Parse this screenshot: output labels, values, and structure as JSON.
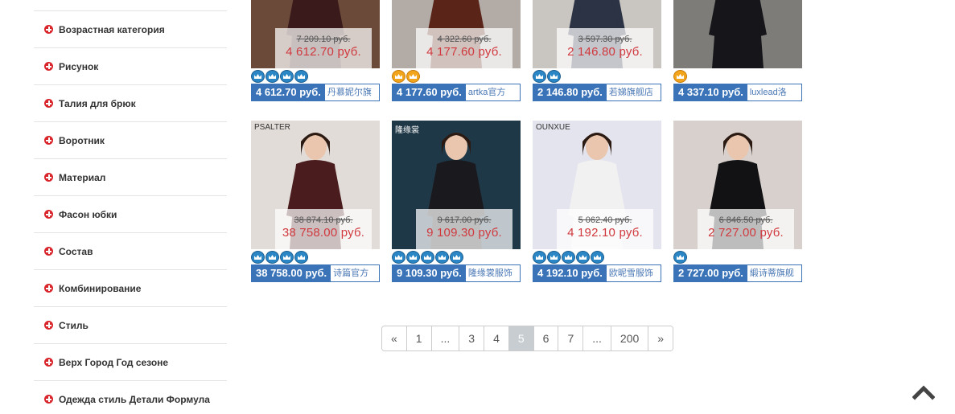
{
  "sidebar": {
    "items": [
      {
        "label": "Возрастная категория"
      },
      {
        "label": "Рисунок"
      },
      {
        "label": "Талия для брюк"
      },
      {
        "label": "Воротник"
      },
      {
        "label": "Материал"
      },
      {
        "label": "Фасон юбки"
      },
      {
        "label": "Состав"
      },
      {
        "label": "Комбинирование"
      },
      {
        "label": "Стиль"
      },
      {
        "label": "Верх Город Год сезоне"
      },
      {
        "label": "Одежда стиль Детали Формула"
      }
    ]
  },
  "products": [
    {
      "old_price": "7 209.10 руб.",
      "new_price": "4 612.70 руб.",
      "buy_price": "4 612.70 руб.",
      "shop": "丹慕妮尔旗",
      "crowns": [
        "blue",
        "blue",
        "blue",
        "blue"
      ],
      "bg": "#6b4a3a",
      "dress": "#3a1a1a"
    },
    {
      "old_price": "4 322.60 руб.",
      "new_price": "4 177.60 руб.",
      "buy_price": "4 177.60 руб.",
      "shop": "artka官方",
      "crowns": [
        "gold",
        "gold"
      ],
      "bg": "#b3aca6",
      "dress": "#5a2418"
    },
    {
      "old_price": "3 597.30 руб.",
      "new_price": "2 146.80 руб.",
      "buy_price": "2 146.80 руб.",
      "shop": "若娣旗舰店",
      "crowns": [
        "blue",
        "blue"
      ],
      "bg": "#c9c6c2",
      "dress": "#2b3344"
    },
    {
      "old_price": "",
      "new_price": "",
      "buy_price": "4 337.10 руб.",
      "shop": "luxlead洛",
      "crowns": [
        "gold"
      ],
      "bg": "#7d7c78",
      "dress": "#15151a"
    },
    {
      "old_price": "38 874.10 руб.",
      "new_price": "38 758.00 руб.",
      "buy_price": "38 758.00 руб.",
      "shop": "诗篇官方",
      "crowns": [
        "blue",
        "blue",
        "blue",
        "blue"
      ],
      "bg": "#e2dcd8",
      "dress": "#4a1c1e",
      "brand": "PSALTER"
    },
    {
      "old_price": "9 617.00 руб.",
      "new_price": "9 109.30 руб.",
      "buy_price": "9 109.30 руб.",
      "shop": "隆缘裳服饰",
      "crowns": [
        "blue",
        "blue",
        "blue",
        "blue",
        "blue"
      ],
      "bg": "#1f3848",
      "dress": "#1a1a1e",
      "brand": "隆缘裳"
    },
    {
      "old_price": "5 062.40 руб.",
      "new_price": "4 192.10 руб.",
      "buy_price": "4 192.10 руб.",
      "shop": "欧昵雪服饰",
      "crowns": [
        "blue",
        "blue",
        "blue",
        "blue",
        "blue"
      ],
      "bg": "#e4e4ee",
      "dress": "#f1f1f1",
      "brand": "OUNXUE"
    },
    {
      "old_price": "6 846.50 руб.",
      "new_price": "2 727.00 руб.",
      "buy_price": "2 727.00 руб.",
      "shop": "緞诗蒂旗舰",
      "crowns": [
        "blue"
      ],
      "bg": "#d8d0cc",
      "dress": "#121214"
    }
  ],
  "pagination": [
    "«",
    "1",
    "...",
    "3",
    "4",
    "5",
    "6",
    "7",
    "...",
    "200",
    "»"
  ],
  "pagination_active": "5",
  "colors": {
    "accent": "#3a73b8",
    "price_red": "#d0393e",
    "plus_red": "#d9262c"
  }
}
